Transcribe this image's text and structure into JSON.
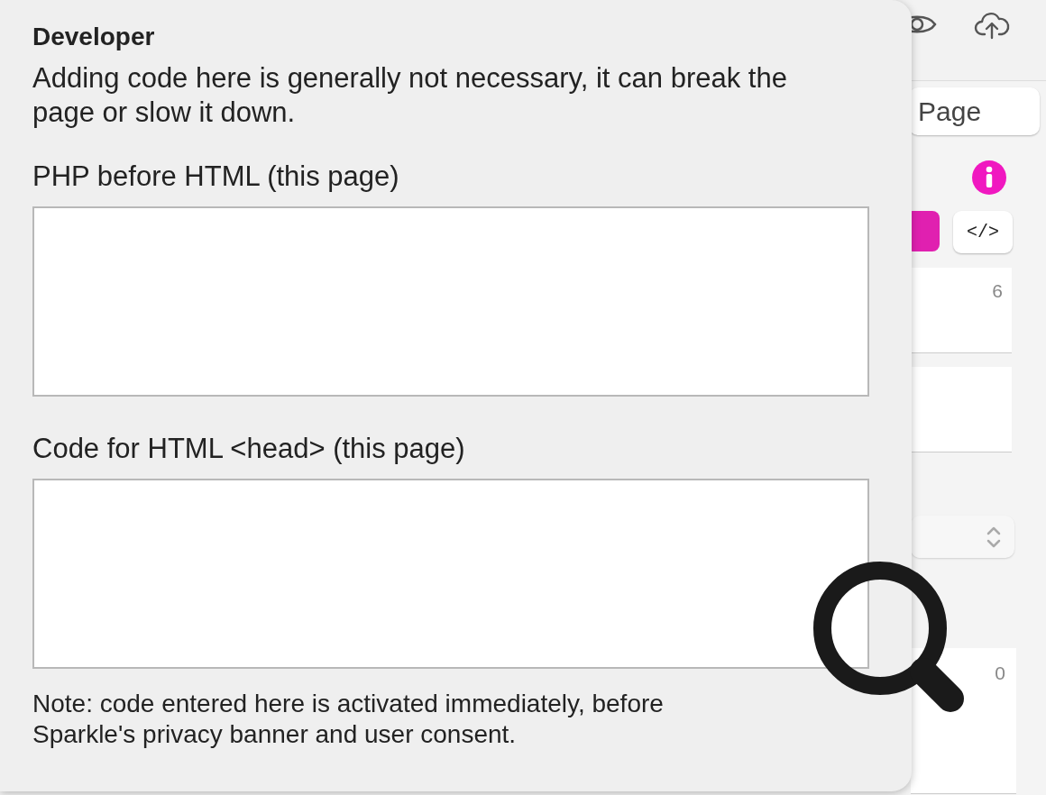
{
  "toolbar": {
    "icons": [
      {
        "kind": "eye"
      },
      {
        "kind": "cloud-upload"
      }
    ]
  },
  "inspector": {
    "page_tab": "Page",
    "code_button": "</>",
    "fields": [
      {
        "kind": "number",
        "value": "6"
      },
      {
        "kind": "blank"
      }
    ],
    "bottom_field": {
      "value": "0"
    }
  },
  "popover": {
    "title": "Developer",
    "description": "Adding code here is generally not necessary, it can break the page or slow it down.",
    "code_fields": [
      {
        "label": "PHP before HTML (this page)"
      },
      {
        "label": "Code for HTML <head> (this page)"
      }
    ],
    "note": "Note: code entered here is activated immediately, before Sparkle's privacy banner and user consent."
  }
}
